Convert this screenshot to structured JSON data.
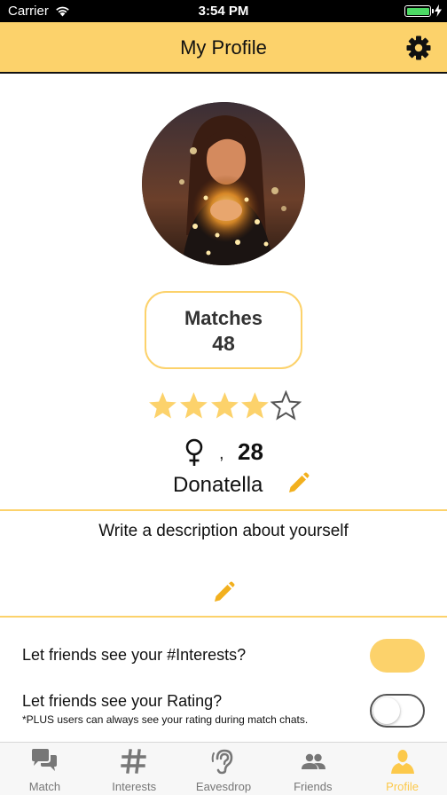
{
  "status_bar": {
    "carrier": "Carrier",
    "time": "3:54 PM",
    "battery_color": "#4cd964"
  },
  "header": {
    "title": "My Profile",
    "settings_icon": "gear-icon",
    "background": "#fcd26b"
  },
  "profile": {
    "matches_label": "Matches",
    "matches_count": "48",
    "rating": 4,
    "rating_max": 5,
    "gender_symbol": "♀",
    "separator": ",",
    "age": "28",
    "name": "Donatella",
    "description_prompt": "Write a description about yourself"
  },
  "settings": {
    "interests_label": "Let friends see your #Interests?",
    "interests_enabled": true,
    "rating_label": "Let friends see your Rating?",
    "rating_note": "*PLUS users can always see your rating during match chats.",
    "rating_enabled": false
  },
  "tabs": [
    {
      "label": "Match",
      "icon": "chat-bubbles-icon",
      "active": false
    },
    {
      "label": "Interests",
      "icon": "hashtag-icon",
      "active": false
    },
    {
      "label": "Eavesdrop",
      "icon": "ear-icon",
      "active": false
    },
    {
      "label": "Friends",
      "icon": "friends-icon",
      "active": false
    },
    {
      "label": "Profile",
      "icon": "profile-icon",
      "active": true
    }
  ],
  "colors": {
    "accent": "#fcd26b",
    "tab_active": "#fcc94b",
    "tab_inactive": "#777777"
  }
}
